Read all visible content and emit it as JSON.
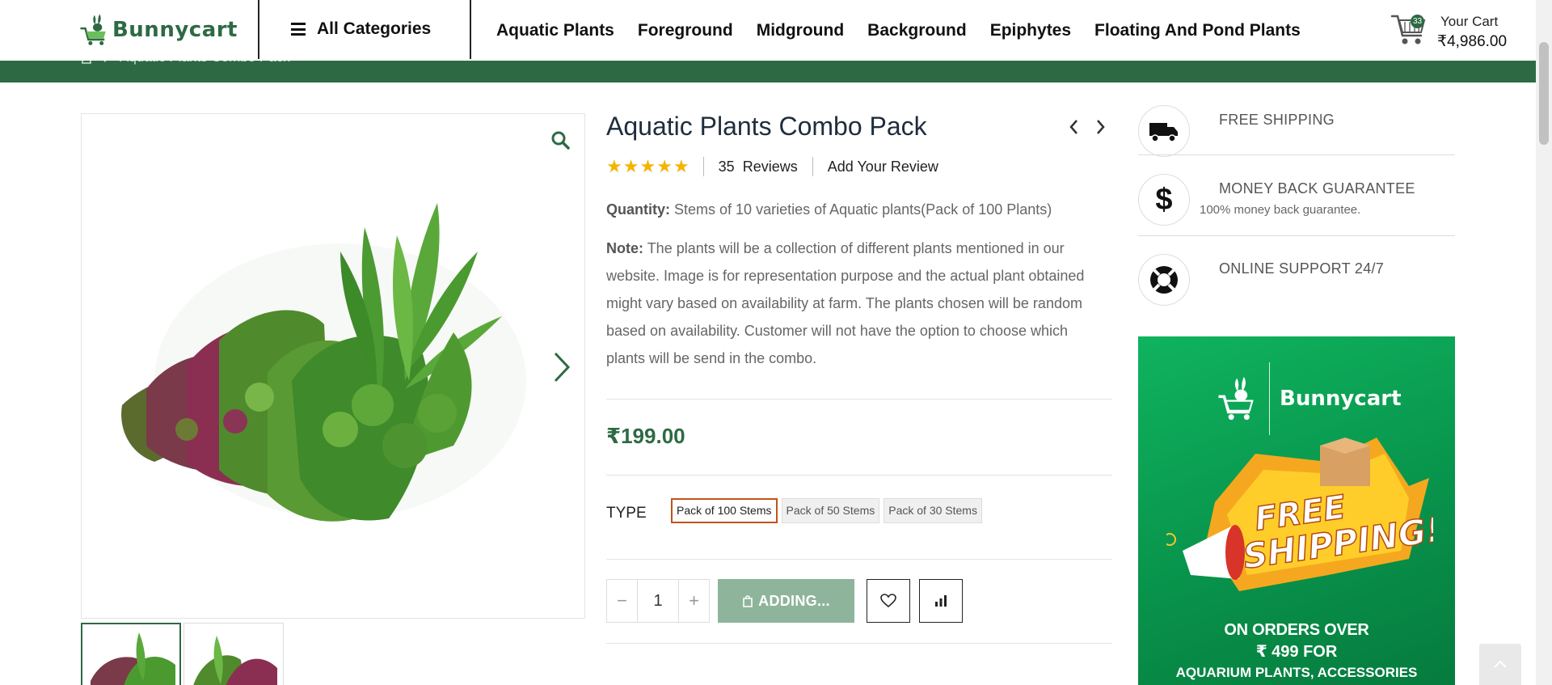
{
  "header": {
    "logo_text": "Bunnycart",
    "all_categories": "All Categories",
    "nav": [
      "Aquatic Plants",
      "Foreground",
      "Midground",
      "Background",
      "Epiphytes",
      "Floating And Pond Plants"
    ],
    "cart": {
      "count": "33",
      "label": "Your Cart",
      "total": "₹4,986.00"
    }
  },
  "breadcrumb": {
    "current": "Aquatic Plants Combo Pack"
  },
  "product": {
    "title": "Aquatic Plants Combo Pack",
    "rating": {
      "stars": 5,
      "max": 5
    },
    "reviews_count": "35",
    "reviews_label": "Reviews",
    "add_review": "Add Your Review",
    "quantity_label": "Quantity:",
    "quantity_text": "Stems of 10 varieties of Aquatic plants(Pack of 100 Plants)",
    "note_label": "Note:",
    "note_text": "The plants will be a collection of different plants mentioned in our website. Image is for representation purpose and the actual plant obtained might vary based on availability at farm. The plants chosen will be random based on availability. Customer will not have the option to choose which plants will be send in the combo.",
    "price": "₹199.00",
    "type_label": "TYPE",
    "type_options": [
      "Pack of 100 Stems",
      "Pack of 50 Stems",
      "Pack of 30 Stems"
    ],
    "selected_type": "Pack of 100 Stems",
    "quantity_value": "1",
    "add_button_label": "ADDING..."
  },
  "sidebar": {
    "features": [
      {
        "title": "FREE SHIPPING",
        "subtitle": "",
        "icon": "truck-icon"
      },
      {
        "title": "MONEY BACK GUARANTEE",
        "subtitle": "100% money back guarantee.",
        "icon": "dollar-icon"
      },
      {
        "title": "ONLINE SUPPORT 24/7",
        "subtitle": "",
        "icon": "lifebuoy-icon"
      }
    ],
    "banner": {
      "logo_text": "Bunnycart",
      "headline_1": "FREE",
      "headline_2": "SHIPPING!",
      "line_1": "ON ORDERS OVER",
      "line_2": "₹ 499 FOR",
      "line_3": "AQUARIUM PLANTS, ACCESSORIES"
    }
  },
  "colors": {
    "brand_green": "#2d6a44",
    "star": "#f4b400",
    "selected_border": "#c0531b",
    "add_button": "#8fb49c"
  }
}
